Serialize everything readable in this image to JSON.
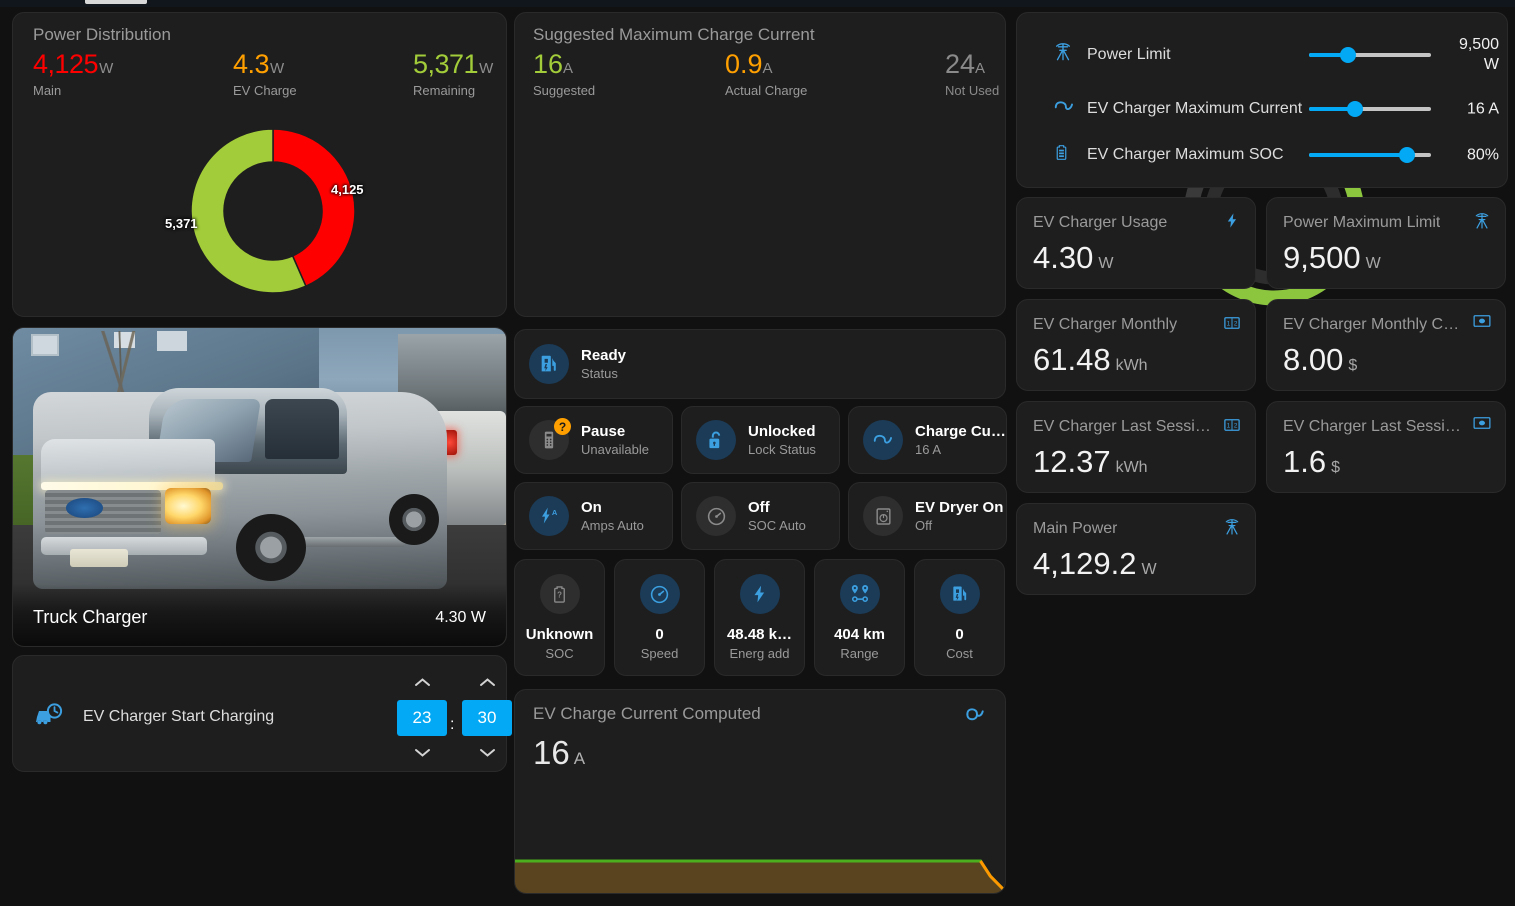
{
  "power_distribution": {
    "title": "Power Distribution",
    "stats": [
      {
        "value": "4,125",
        "unit": "W",
        "label": "Main",
        "color": "#ff0000"
      },
      {
        "value": "4.3",
        "unit": "W",
        "label": "EV Charge",
        "color": "#ffa000"
      },
      {
        "value": "5,371",
        "unit": "W",
        "label": "Remaining",
        "color": "#a2cc39"
      }
    ],
    "donut_label_red": "4,125",
    "donut_label_green": "5,371"
  },
  "suggested": {
    "title": "Suggested Maximum Charge Current",
    "stats": [
      {
        "value": "16",
        "unit": "A",
        "label": "Suggested",
        "color": "#a2cc39"
      },
      {
        "value": "0.9",
        "unit": "A",
        "label": "Actual Charge",
        "color": "#ffa000"
      },
      {
        "value": "24",
        "unit": "A",
        "label": "Not Used",
        "color": "#8a8a8a"
      }
    ]
  },
  "chart_data": [
    {
      "type": "pie",
      "title": "Power Distribution",
      "categories": [
        "Main",
        "Remaining"
      ],
      "values": [
        4125,
        5371
      ],
      "colors": [
        "#ff0000",
        "#a2cc39"
      ],
      "labels": [
        "4,125",
        "5,371"
      ],
      "unit": "W",
      "donut": true
    },
    {
      "type": "gauge",
      "title": "Suggested Maximum Charge Current",
      "series": [
        {
          "name": "Suggested",
          "value": 16,
          "max": 24,
          "color": "#8cc63f"
        },
        {
          "name": "Actual Charge",
          "value": 0.9,
          "max": 24,
          "color": "#ffa000"
        }
      ],
      "unit": "A",
      "ylim": [
        0,
        24
      ]
    },
    {
      "type": "area",
      "title": "EV Charge Current Computed",
      "ylabel": "A",
      "current_value": 16,
      "line_color": "#4caf1e",
      "fill_color": "#5a4420",
      "drop_color": "#ff9800",
      "x": [
        0,
        10,
        20,
        30,
        40,
        50,
        60,
        70,
        80,
        90,
        95,
        97,
        100
      ],
      "values": [
        16,
        16,
        16,
        16,
        16,
        16,
        16,
        16,
        16,
        16,
        16,
        8,
        0
      ]
    }
  ],
  "truck": {
    "name": "Truck Charger",
    "value": "4.30 W"
  },
  "time_picker": {
    "label": "EV Charger Start Charging",
    "hour": "23",
    "separator": ":",
    "minute": "30",
    "up_arrow": "⌃",
    "down_arrow": "⌄"
  },
  "status": {
    "primary": {
      "title": "Ready",
      "subtitle": "Status",
      "icon": "ev-station-icon"
    },
    "badges": [
      {
        "title": "Pause",
        "subtitle": "Unavailable",
        "icon": "remote-icon",
        "state": "unavailable",
        "badge": "?"
      },
      {
        "title": "Unlocked",
        "subtitle": "Lock Status",
        "icon": "lock-open-icon",
        "state": "active"
      },
      {
        "title": "Charge Cu…",
        "subtitle": "16 A",
        "icon": "sine-wave-icon",
        "state": "active"
      },
      {
        "title": "On",
        "subtitle": "Amps Auto",
        "icon": "flash-auto-icon",
        "state": "active"
      },
      {
        "title": "Off",
        "subtitle": "SOC Auto",
        "icon": "gauge-icon",
        "state": "inactive"
      },
      {
        "title": "EV Dryer On",
        "subtitle": "Off",
        "icon": "washing-machine-icon",
        "state": "inactive"
      }
    ]
  },
  "tiles": [
    {
      "value": "Unknown",
      "label": "SOC",
      "icon": "battery-unknown-icon",
      "state": "inactive"
    },
    {
      "value": "0",
      "label": "Speed",
      "icon": "speedometer-icon",
      "state": "active"
    },
    {
      "value": "48.48 k…",
      "label": "Energ add",
      "icon": "lightning-bolt-icon",
      "state": "active"
    },
    {
      "value": "404 km",
      "label": "Range",
      "icon": "map-marker-path-icon",
      "state": "active"
    },
    {
      "value": "0",
      "label": "Cost",
      "icon": "ev-station-icon",
      "state": "active"
    }
  ],
  "computed_card": {
    "title": "EV Charge Current Computed",
    "value": "16",
    "unit": "A",
    "icon": "sine-wave-icon"
  },
  "sliders": [
    {
      "name": "Power Limit",
      "value": "9,500\nW",
      "icon": "transmission-tower-icon",
      "percent": 32
    },
    {
      "name": "EV Charger Maximum Current",
      "value": "16 A",
      "icon": "sine-wave-icon",
      "percent": 38
    },
    {
      "name": "EV Charger Maximum SOC",
      "value": "80%",
      "icon": "battery-icon",
      "percent": 80
    }
  ],
  "stat_cards": [
    {
      "label": "EV Charger Usage",
      "value": "4.30",
      "unit": "W",
      "icon": "lightning-bolt-icon"
    },
    {
      "label": "Power Maximum Limit",
      "value": "9,500",
      "unit": "W",
      "icon": "transmission-tower-icon"
    },
    {
      "label": "EV Charger Monthly",
      "value": "61.48",
      "unit": "kWh",
      "icon": "counter-icon"
    },
    {
      "label": "EV Charger Monthly Cost",
      "value": "8.00",
      "unit": "$",
      "icon": "cash-icon"
    },
    {
      "label": "EV Charger Last Session",
      "value": "12.37",
      "unit": "kWh",
      "icon": "counter-icon"
    },
    {
      "label": "EV Charger Last Sessio…",
      "value": "1.6",
      "unit": "$",
      "icon": "cash-icon"
    },
    {
      "label": "Main Power",
      "value": "4,129.2",
      "unit": "W",
      "icon": "transmission-tower-icon"
    }
  ],
  "theme": {
    "accent": "#03a9f4",
    "green": "#a2cc39",
    "red": "#ff0000",
    "orange": "#ffa000",
    "card_bg": "#1e1e1e",
    "page_bg": "#111111"
  }
}
